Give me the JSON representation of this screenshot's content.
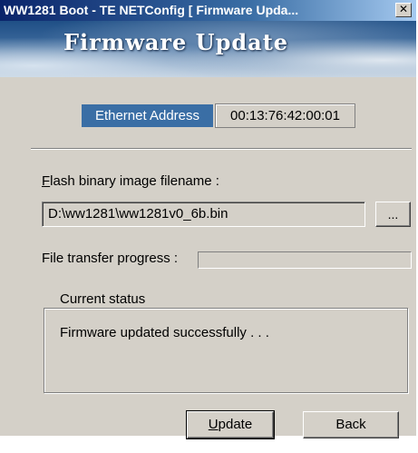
{
  "window": {
    "title": "WW1281 Boot - TE NETConfig [ Firmware Upda...",
    "close_glyph": "✕"
  },
  "banner": {
    "title": "Firmware Update"
  },
  "ethernet": {
    "label": "Ethernet Address",
    "value": "00:13:76:42:00:01"
  },
  "flash": {
    "label_accel": "F",
    "label_rest": "lash binary image filename :",
    "value": "D:\\ww1281\\ww1281v0_6b.bin",
    "browse_label": "..."
  },
  "progress": {
    "label": "File transfer progress :",
    "value_percent": 0
  },
  "status": {
    "legend": "Current status",
    "text": "Firmware updated successfully . . ."
  },
  "buttons": {
    "update_accel": "U",
    "update_rest": "pdate",
    "back_label": "Back"
  },
  "colors": {
    "titlebar": "#0a246a",
    "face": "#d4d0c8",
    "eth_label_bg": "#3a6ea5"
  }
}
